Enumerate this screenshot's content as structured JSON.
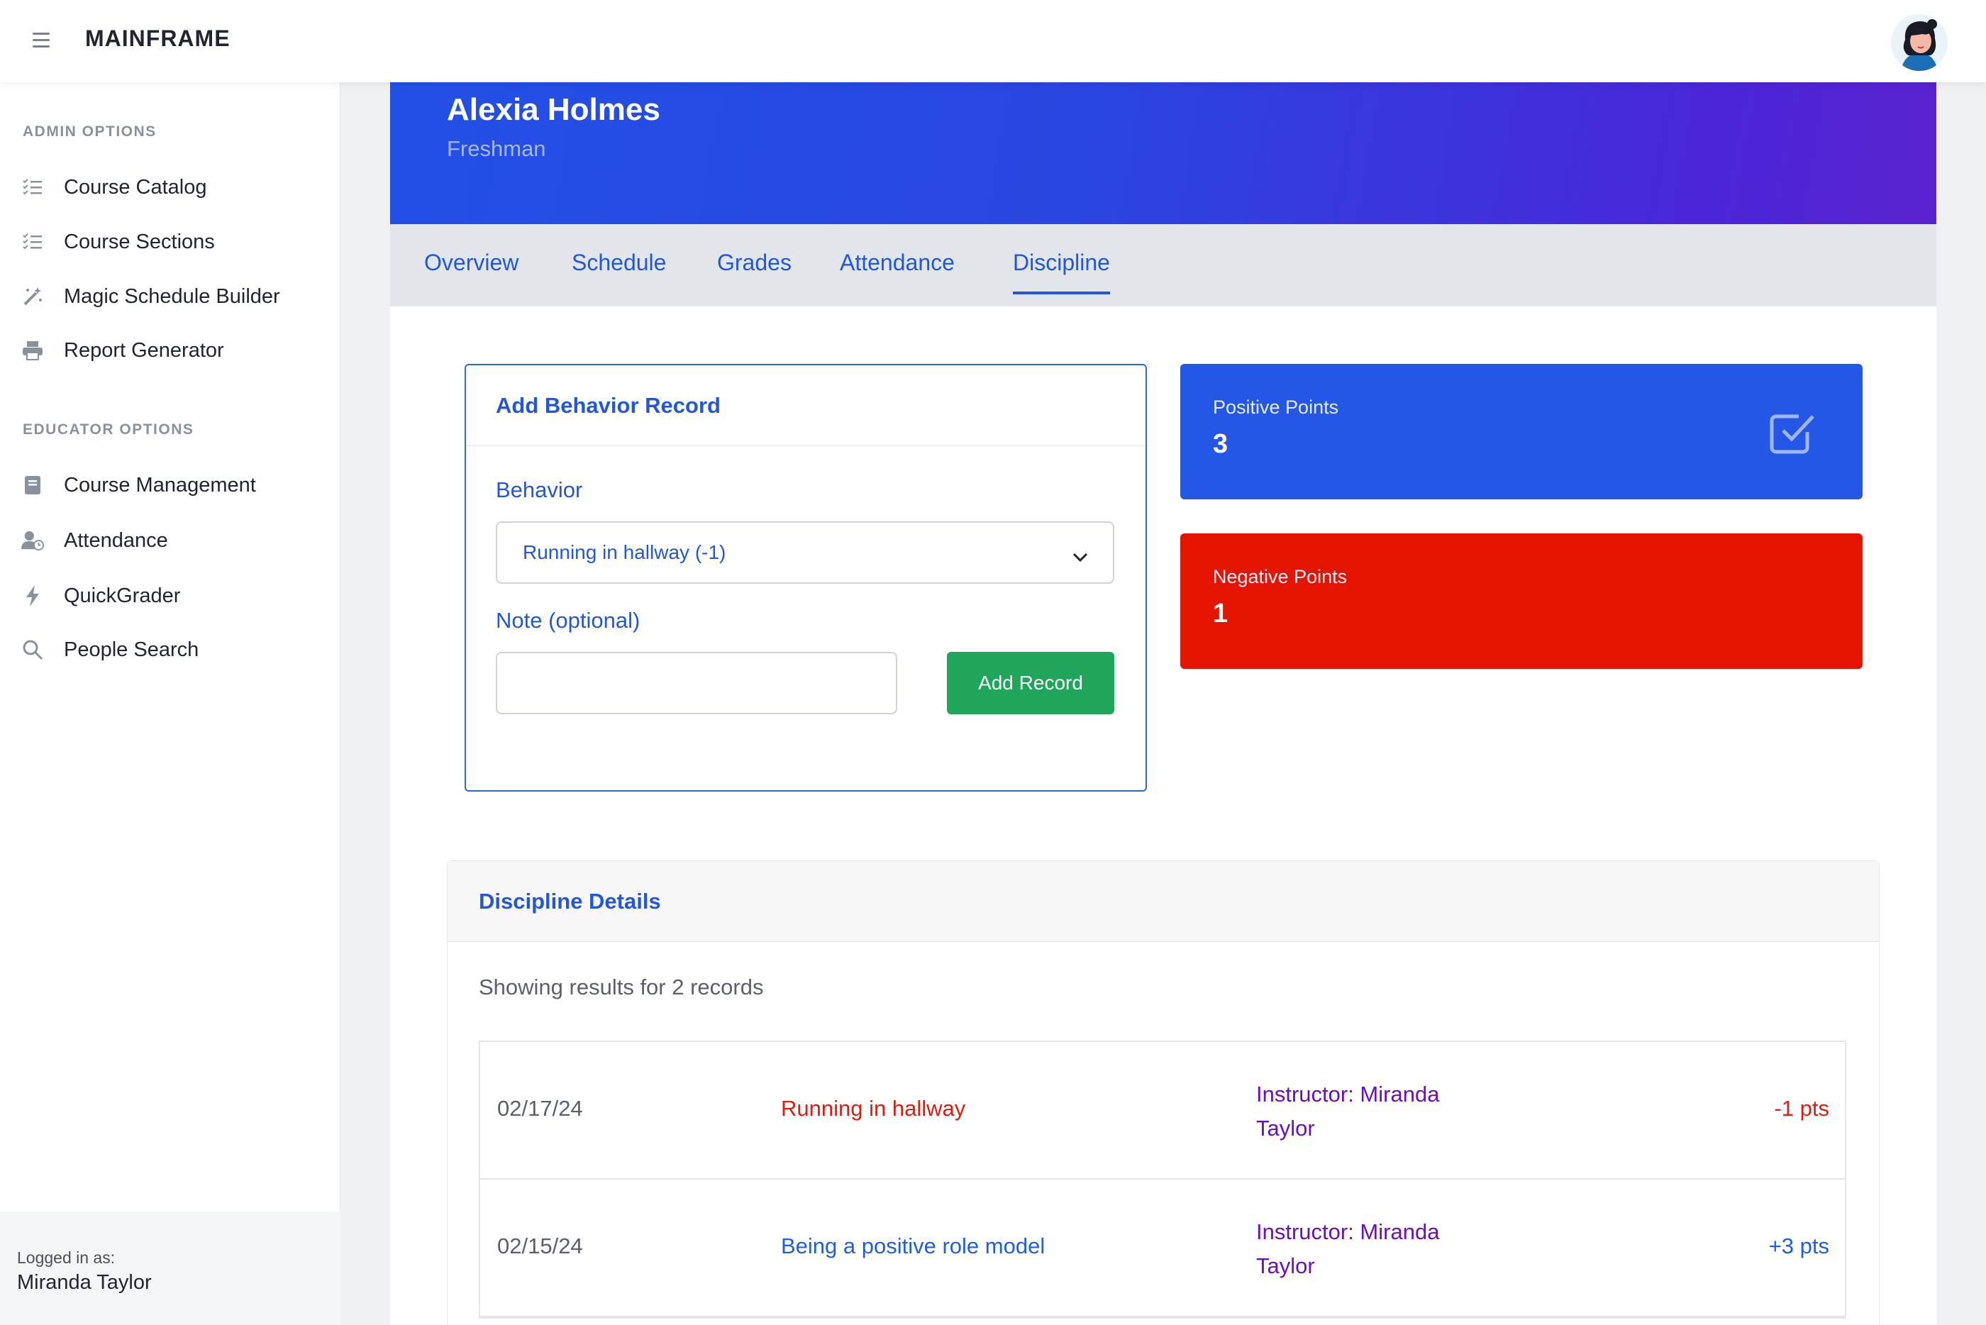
{
  "app": {
    "brand": "MAINFRAME"
  },
  "sidebar": {
    "admin_heading": "ADMIN OPTIONS",
    "admin_items": [
      {
        "label": "Course Catalog",
        "icon": "list-check-icon"
      },
      {
        "label": "Course Sections",
        "icon": "list-check-icon"
      },
      {
        "label": "Magic Schedule Builder",
        "icon": "magic-wand-icon"
      },
      {
        "label": "Report Generator",
        "icon": "printer-icon"
      }
    ],
    "educator_heading": "EDUCATOR OPTIONS",
    "educator_items": [
      {
        "label": "Course Management",
        "icon": "book-icon"
      },
      {
        "label": "Attendance",
        "icon": "user-clock-icon"
      },
      {
        "label": "QuickGrader",
        "icon": "lightning-icon"
      },
      {
        "label": "People Search",
        "icon": "search-icon"
      }
    ],
    "footer": {
      "logged_in_label": "Logged in as:",
      "user_name": "Miranda Taylor"
    }
  },
  "student": {
    "name": "Alexia Holmes",
    "grade_level": "Freshman"
  },
  "tabs": [
    {
      "label": "Overview"
    },
    {
      "label": "Schedule"
    },
    {
      "label": "Grades"
    },
    {
      "label": "Attendance"
    },
    {
      "label": "Discipline",
      "active": true
    }
  ],
  "behavior_form": {
    "title": "Add Behavior Record",
    "behavior_label": "Behavior",
    "behavior_value": "Running in hallway (-1)",
    "note_label": "Note (optional)",
    "note_value": "",
    "submit_label": "Add Record"
  },
  "points": {
    "positive": {
      "label": "Positive Points",
      "value": "3",
      "color": "#2457e6"
    },
    "negative": {
      "label": "Negative Points",
      "value": "1",
      "color": "#e51400"
    }
  },
  "details": {
    "title": "Discipline Details",
    "summary": "Showing results for 2 records",
    "records": [
      {
        "date": "02/17/24",
        "behavior": "Running in hallway",
        "instructor": "Instructor: Miranda Taylor",
        "points": "-1 pts",
        "type": "negative"
      },
      {
        "date": "02/15/24",
        "behavior": "Being a positive role model",
        "instructor": "Instructor: Miranda Taylor",
        "points": "+3 pts",
        "type": "positive"
      }
    ]
  }
}
